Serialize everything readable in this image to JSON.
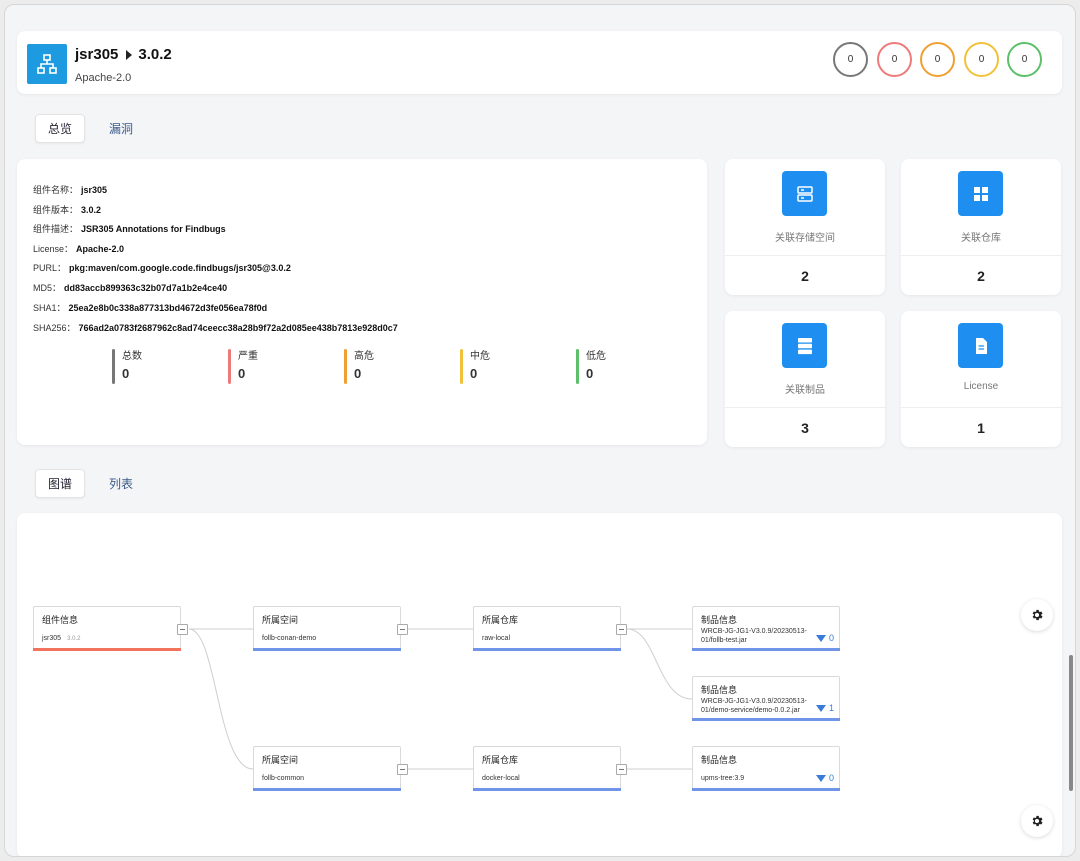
{
  "header": {
    "name": "jsr305",
    "version": "3.0.2",
    "license": "Apache-2.0",
    "circles": [
      {
        "value": "0",
        "color": "#777777"
      },
      {
        "value": "0",
        "color": "#ee7a7a"
      },
      {
        "value": "0",
        "color": "#f0a030"
      },
      {
        "value": "0",
        "color": "#f2c13a"
      },
      {
        "value": "0",
        "color": "#5cbf6a"
      }
    ]
  },
  "tabs1": {
    "overview": "总览",
    "vulnerability": "漏洞"
  },
  "info": {
    "name_k": "组件名称：",
    "name_v": "jsr305",
    "version_k": "组件版本：",
    "version_v": "3.0.2",
    "desc_k": "组件描述：",
    "desc_v": "JSR305 Annotations for Findbugs",
    "license_k": "License：",
    "license_v": "Apache-2.0",
    "purl_k": "PURL：",
    "purl_v": "pkg:maven/com.google.code.findbugs/jsr305@3.0.2",
    "md5_k": "MD5：",
    "md5_v": "dd83accb899363c32b07d7a1b2e4ce40",
    "sha1_k": "SHA1：",
    "sha1_v": "25ea2e8b0c338a877313bd4672d3fe056ea78f0d",
    "sha256_k": "SHA256：",
    "sha256_v": "766ad2a0783f2687962c8ad74ceecc38a28b9f72a2d085ee438b7813e928d0c7"
  },
  "stats": [
    {
      "label": "总数",
      "value": "0",
      "color": "#777777"
    },
    {
      "label": "严重",
      "value": "0",
      "color": "#ee7a7a"
    },
    {
      "label": "高危",
      "value": "0",
      "color": "#f0a030"
    },
    {
      "label": "中危",
      "value": "0",
      "color": "#f2c13a"
    },
    {
      "label": "低危",
      "value": "0",
      "color": "#5cbf6a"
    }
  ],
  "tiles": {
    "storage": {
      "label": "关联存储空间",
      "value": "2"
    },
    "repo": {
      "label": "关联仓库",
      "value": "2"
    },
    "artifact": {
      "label": "关联制品",
      "value": "3"
    },
    "license": {
      "label": "License",
      "value": "1"
    }
  },
  "tabs2": {
    "graph": "图谱",
    "list": "列表"
  },
  "graph": {
    "component": {
      "title": "组件信息",
      "name": "jsr305",
      "version": "3.0.2"
    },
    "space1": {
      "title": "所属空间",
      "value": "follb-conan-demo"
    },
    "space2": {
      "title": "所属空间",
      "value": "follb-common"
    },
    "repo1": {
      "title": "所属仓库",
      "value": "raw-local"
    },
    "repo2": {
      "title": "所属仓库",
      "value": "docker-local"
    },
    "art1": {
      "title": "制品信息",
      "value": "WRCB-JG-JG1-V3.0.9/20230513-01/follb-test.jar",
      "count": "0"
    },
    "art2": {
      "title": "制品信息",
      "value": "WRCB-JG-JG1-V3.0.9/20230513-01/demo-service/demo-0.0.2.jar",
      "count": "1"
    },
    "art3": {
      "title": "制品信息",
      "value": "upms-tree:3.9",
      "count": "0"
    }
  }
}
